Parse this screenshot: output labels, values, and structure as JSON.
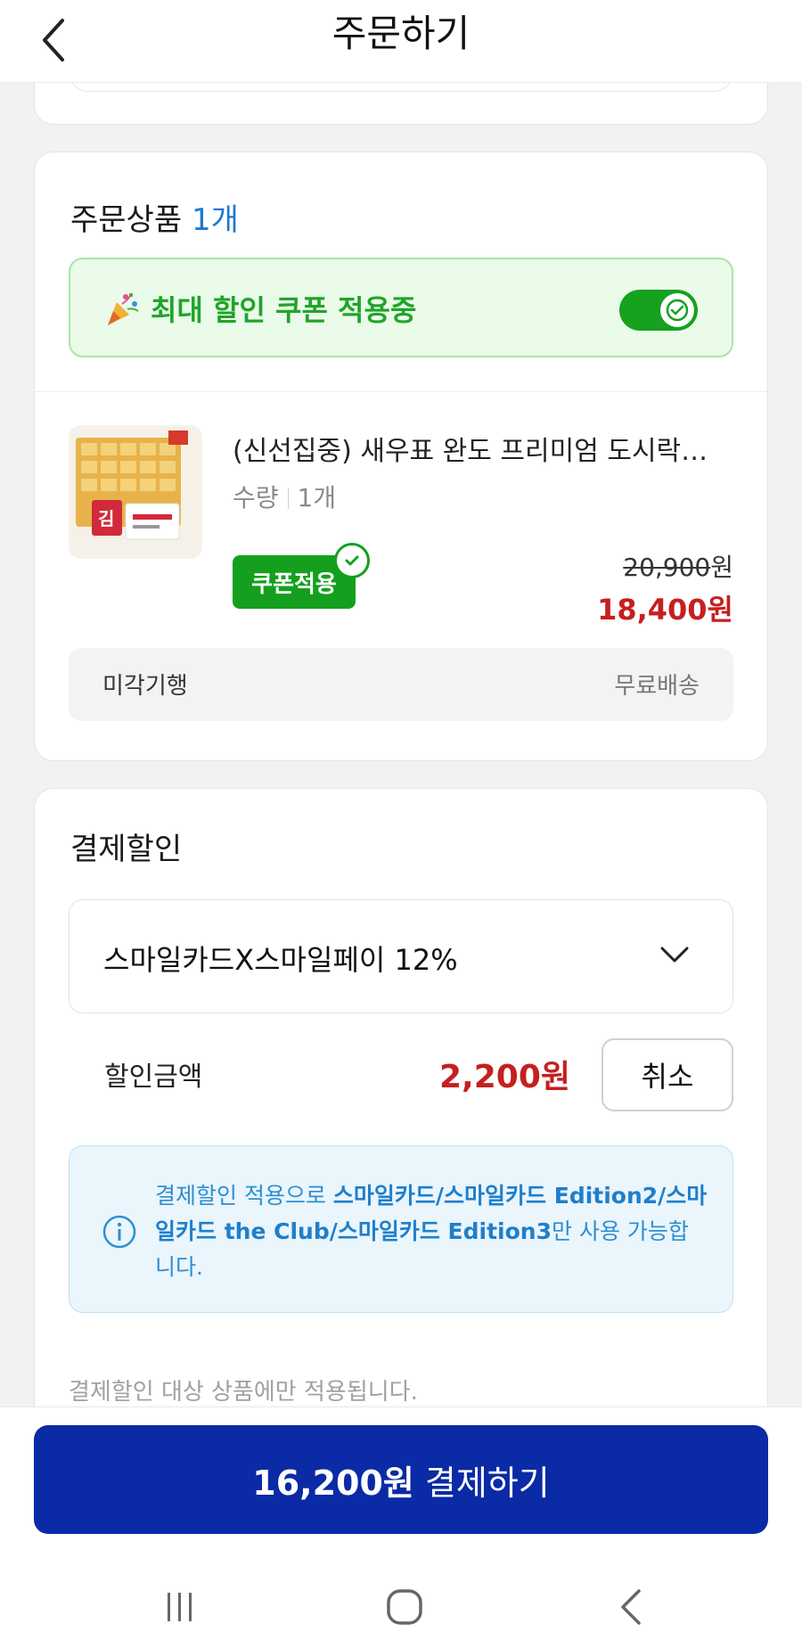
{
  "header": {
    "title": "주문하기",
    "back_icon": "chevron-left-icon"
  },
  "order": {
    "title": "주문상품",
    "count": "1개",
    "coupon_banner": {
      "text": "최대 할인 쿠폰 적용중",
      "toggle_on": true,
      "icon": "party-popper-icon"
    },
    "product": {
      "name": "(신선집중) 새우표 완도 프리미엄 도시락…",
      "qty_label": "수량",
      "qty_value": "1개",
      "coupon_chip": "쿠폰적용",
      "original_price": "20,900",
      "original_unit": "원",
      "sale_price": "18,400원"
    },
    "delivery": {
      "seller": "미각기행",
      "shipping": "무료배송"
    }
  },
  "payment_discount": {
    "title": "결제할인",
    "selected_option": "스마일카드X스마일페이 12%",
    "discount_label": "할인금액",
    "discount_amount": "2,200원",
    "cancel_label": "취소",
    "info": {
      "prefix": "결제할인 적용으로 ",
      "cards": "스마일카드/스마일카드 Edition2/스마일카드 the Club/스마일카드 Edition3",
      "suffix": "만 사용 가능합니다."
    },
    "footnote": "결제할인 대상 상품에만 적용됩니다."
  },
  "checkout": {
    "amount": "16,200원",
    "label": "결제하기"
  },
  "colors": {
    "accent_blue": "#0a2aa6",
    "coupon_green": "#14a01e",
    "price_red": "#c61f1f",
    "info_blue": "#2d8fd1"
  }
}
